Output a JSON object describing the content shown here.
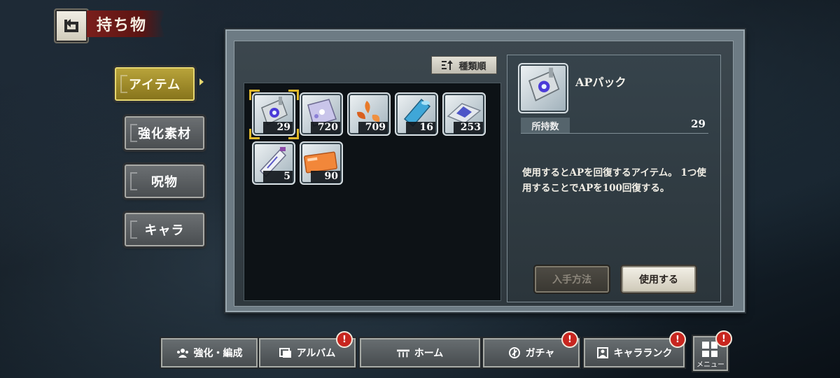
{
  "header": {
    "title": "持ち物",
    "back_icon": "return-arrow-icon"
  },
  "sidebar": {
    "items": [
      {
        "label": "アイテム",
        "active": true
      },
      {
        "label": "強化素材",
        "active": false
      },
      {
        "label": "呪物",
        "active": false
      },
      {
        "label": "キャラ",
        "active": false
      }
    ]
  },
  "toolbar": {
    "sort_label": "種類順",
    "sort_icon": "sort-icon"
  },
  "items": [
    {
      "icon": "ap-pack-icon",
      "count": "29",
      "selected": true
    },
    {
      "icon": "crystal-box-icon",
      "count": "720",
      "selected": false
    },
    {
      "icon": "orange-petals-icon",
      "count": "709",
      "selected": false
    },
    {
      "icon": "blue-cylinder-icon",
      "count": "16",
      "selected": false
    },
    {
      "icon": "crystal-shards-icon",
      "count": "253",
      "selected": false
    },
    {
      "icon": "talisman-icon",
      "count": "5",
      "selected": false
    },
    {
      "icon": "orange-ticket-icon",
      "count": "90",
      "selected": false
    }
  ],
  "detail": {
    "name": "APパック",
    "quantity_label": "所持数",
    "quantity": "29",
    "description": "使用するとAPを回復するアイテム。 1つ使用することでAPを100回復する。",
    "obtain_label": "入手方法",
    "use_label": "使用する"
  },
  "bottom_nav": [
    {
      "label": "強化・編成",
      "icon": "team-icon",
      "alert": false
    },
    {
      "label": "アルバム",
      "icon": "album-icon",
      "alert": true
    },
    {
      "label": "ホーム",
      "icon": "home-icon",
      "alert": false
    },
    {
      "label": "ガチャ",
      "icon": "gacha-icon",
      "alert": true
    },
    {
      "label": "キャラランク",
      "icon": "character-rank-icon",
      "alert": true
    }
  ],
  "menu": {
    "label": "メニュー",
    "alert": true,
    "alert_mark": "!"
  },
  "colors": {
    "accent_gold": "#e0b82a",
    "alert_red": "#c8261f",
    "title_red": "#7a1f1c"
  }
}
